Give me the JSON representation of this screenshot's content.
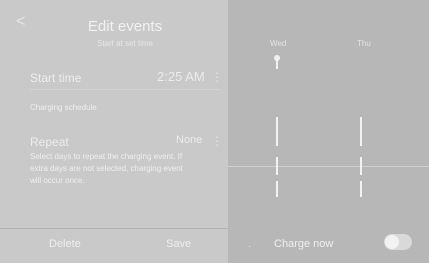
{
  "header": {
    "back_label": "<",
    "title": "Edit events",
    "subtitle": "Start at set time"
  },
  "start_time": {
    "label": "Start time",
    "value": "2:25 AM",
    "more": "⋮"
  },
  "schedule_label": "Charging schedule",
  "repeat": {
    "label": "Repeat",
    "value": "None",
    "more": "⋮",
    "description": "Select days to repeat the charging event. If extra days are not selected, charging event will occur once."
  },
  "buttons": {
    "delete": "Delete",
    "save": "Save"
  },
  "schedule_panel": {
    "days": [
      "Wed",
      "Thu"
    ],
    "charge_now": {
      "label": "Charge now",
      "toggle_on": false
    },
    "indicator": "·"
  }
}
